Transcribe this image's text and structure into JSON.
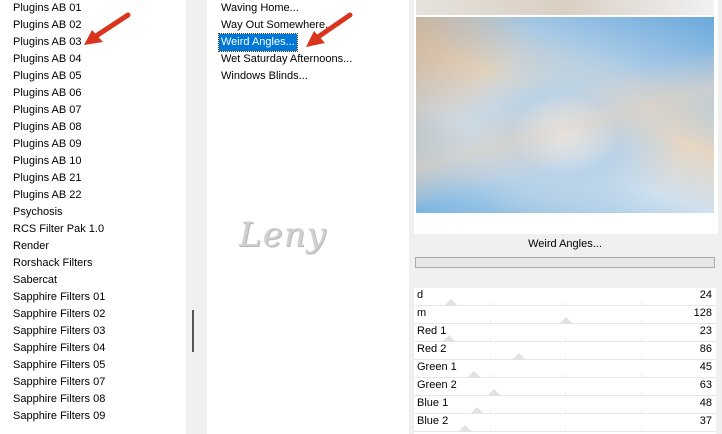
{
  "category_list": {
    "items": [
      "Plugins AB 01",
      "Plugins AB 02",
      "Plugins AB 03",
      "Plugins AB 04",
      "Plugins AB 05",
      "Plugins AB 06",
      "Plugins AB 07",
      "Plugins AB 08",
      "Plugins AB 09",
      "Plugins AB 10",
      "Plugins AB 21",
      "Plugins AB 22",
      "Psychosis",
      "RCS Filter Pak 1.0",
      "Render",
      "Rorshack Filters",
      "Sabercat",
      "Sapphire Filters 01",
      "Sapphire Filters 02",
      "Sapphire Filters 03",
      "Sapphire Filters 04",
      "Sapphire Filters 05",
      "Sapphire Filters 07",
      "Sapphire Filters 08",
      "Sapphire Filters 09"
    ],
    "pointed_item": "Plugins AB 03"
  },
  "filter_list": {
    "items": [
      "Waving Home...",
      "Way Out Somewhere...",
      "Weird Angles...",
      "Wet Saturday Afternoons...",
      "Windows Blinds..."
    ],
    "selected": "Weird Angles..."
  },
  "watermark": "Leny",
  "preview": {
    "filter_name": "Weird Angles..."
  },
  "parameters": [
    {
      "label": "d",
      "value": 24,
      "max": 255
    },
    {
      "label": "m",
      "value": 128,
      "max": 255
    },
    {
      "label": "Red 1",
      "value": 23,
      "max": 255
    },
    {
      "label": "Red 2",
      "value": 86,
      "max": 255
    },
    {
      "label": "Green 1",
      "value": 45,
      "max": 255
    },
    {
      "label": "Green 2",
      "value": 63,
      "max": 255
    },
    {
      "label": "Blue 1",
      "value": 48,
      "max": 255
    },
    {
      "label": "Blue 2",
      "value": 37,
      "max": 255
    }
  ],
  "colors": {
    "selection": "#0078d7",
    "arrow": "#d9341d"
  }
}
